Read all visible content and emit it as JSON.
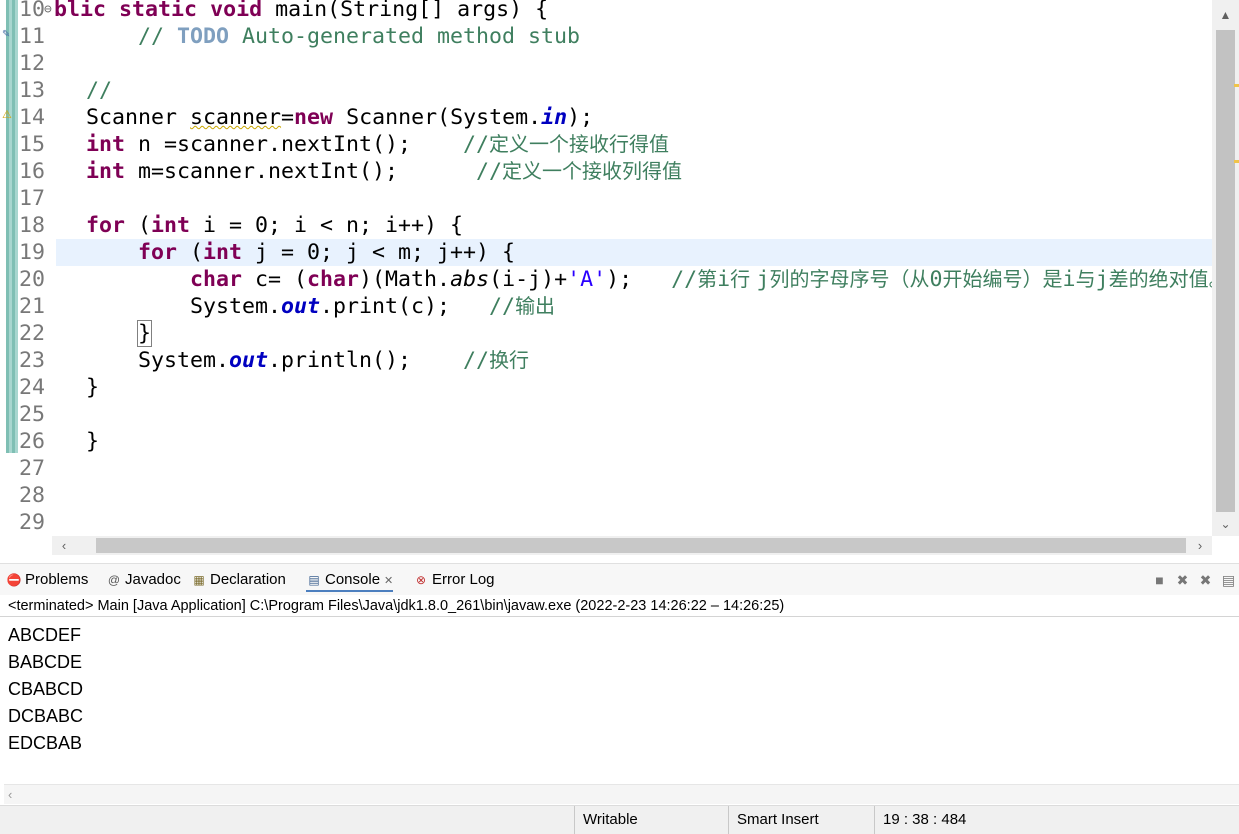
{
  "editor": {
    "lines": [
      {
        "num": "10",
        "fold": "⊖",
        "tokens": [
          {
            "t": "blic",
            "c": "kw"
          },
          {
            "t": " "
          },
          {
            "t": "static",
            "c": "kw"
          },
          {
            "t": " "
          },
          {
            "t": "void",
            "c": "kw"
          },
          {
            "t": " main(String[] args) {"
          }
        ],
        "indent": 0,
        "offset": -32
      },
      {
        "num": "11",
        "tokens": [
          {
            "t": "// ",
            "c": "cm"
          },
          {
            "t": "TODO",
            "c": "todo"
          },
          {
            "t": " Auto-generated method stub",
            "c": "cm"
          }
        ],
        "indent": 4
      },
      {
        "num": "12",
        "tokens": []
      },
      {
        "num": "13",
        "tokens": [
          {
            "t": "//",
            "c": "cm"
          }
        ],
        "indent": 0
      },
      {
        "num": "14",
        "tokens": [
          {
            "t": "Scanner "
          },
          {
            "t": "scanner",
            "c": "warn"
          },
          {
            "t": "="
          },
          {
            "t": "new",
            "c": "kw"
          },
          {
            "t": " Scanner(System."
          },
          {
            "t": "in",
            "c": "fld"
          },
          {
            "t": ");"
          }
        ],
        "indent": 0
      },
      {
        "num": "15",
        "tokens": [
          {
            "t": "int",
            "c": "kw"
          },
          {
            "t": " n =scanner.nextInt();    "
          },
          {
            "t": "//",
            "c": "cm"
          },
          {
            "t": "定义一个接收行得值",
            "c": "cmcjk"
          }
        ],
        "indent": 0
      },
      {
        "num": "16",
        "tokens": [
          {
            "t": "int",
            "c": "kw"
          },
          {
            "t": " m=scanner.nextInt();      "
          },
          {
            "t": "//",
            "c": "cm"
          },
          {
            "t": "定义一个接收列得值",
            "c": "cmcjk"
          }
        ],
        "indent": 0
      },
      {
        "num": "17",
        "tokens": []
      },
      {
        "num": "18",
        "tokens": [
          {
            "t": "for",
            "c": "kw"
          },
          {
            "t": " ("
          },
          {
            "t": "int",
            "c": "kw"
          },
          {
            "t": " i = 0; i < n; i++) {"
          }
        ],
        "indent": 0
      },
      {
        "num": "19",
        "current": true,
        "tokens": [
          {
            "t": "for",
            "c": "kw"
          },
          {
            "t": " ("
          },
          {
            "t": "int",
            "c": "kw"
          },
          {
            "t": " j = 0; j < m; j++) {"
          }
        ],
        "indent": 4
      },
      {
        "num": "20",
        "tokens": [
          {
            "t": "char",
            "c": "kw"
          },
          {
            "t": " c= ("
          },
          {
            "t": "char",
            "c": "kw"
          },
          {
            "t": ")(Math."
          },
          {
            "t": "abs",
            "c": "stat"
          },
          {
            "t": "(i-j)+"
          },
          {
            "t": "'A'",
            "c": "str"
          },
          {
            "t": ");   "
          },
          {
            "t": "//",
            "c": "cm"
          },
          {
            "t": "第",
            "c": "cmcjk"
          },
          {
            "t": "i",
            "c": "cm"
          },
          {
            "t": "行 ",
            "c": "cmcjk"
          },
          {
            "t": "j",
            "c": "cm"
          },
          {
            "t": "列的字母序号（从",
            "c": "cmcjk"
          },
          {
            "t": "0",
            "c": "cm"
          },
          {
            "t": "开始编号）是",
            "c": "cmcjk"
          },
          {
            "t": "i",
            "c": "cm"
          },
          {
            "t": "与",
            "c": "cmcjk"
          },
          {
            "t": "j",
            "c": "cm"
          },
          {
            "t": "差的绝对值。",
            "c": "cmcjk"
          }
        ],
        "indent": 8
      },
      {
        "num": "21",
        "tokens": [
          {
            "t": "System."
          },
          {
            "t": "out",
            "c": "fld"
          },
          {
            "t": ".print(c);   "
          },
          {
            "t": "//",
            "c": "cm"
          },
          {
            "t": "输出",
            "c": "cmcjk"
          }
        ],
        "indent": 8
      },
      {
        "num": "22",
        "tokens": [
          {
            "t": "}",
            "c": "box"
          }
        ],
        "indent": 4
      },
      {
        "num": "23",
        "tokens": [
          {
            "t": "System."
          },
          {
            "t": "out",
            "c": "fld"
          },
          {
            "t": ".println();    "
          },
          {
            "t": "//",
            "c": "cm"
          },
          {
            "t": "换行",
            "c": "cmcjk"
          }
        ],
        "indent": 4
      },
      {
        "num": "24",
        "tokens": [
          {
            "t": "}"
          }
        ],
        "indent": 0
      },
      {
        "num": "25",
        "tokens": []
      },
      {
        "num": "26",
        "tokens": [
          {
            "t": "}"
          }
        ],
        "indent": 0
      },
      {
        "num": "27",
        "tokens": []
      },
      {
        "num": "28",
        "tokens": []
      },
      {
        "num": "29",
        "tokens": []
      }
    ]
  },
  "panel": {
    "tabs": [
      {
        "label": "Problems",
        "icon": "problems-icon",
        "glyph": "⛔",
        "active": false
      },
      {
        "label": "Javadoc",
        "icon": "javadoc-icon",
        "glyph": "@",
        "active": false
      },
      {
        "label": "Declaration",
        "icon": "declaration-icon",
        "glyph": "🗎",
        "active": false
      },
      {
        "label": "Console",
        "icon": "console-icon",
        "glyph": "▤",
        "active": true,
        "close": "✕"
      },
      {
        "label": "Error Log",
        "icon": "error-log-icon",
        "glyph": "⊗",
        "active": false
      }
    ],
    "console_header": "<terminated> Main [Java Application] C:\\Program Files\\Java\\jdk1.8.0_261\\bin\\javaw.exe  (2022-2-23 14:26:22 – 14:26:25)",
    "output_lines": [
      "ABCDEF",
      "BABCDE",
      "CBABCD",
      "DCBABC",
      "EDCBAB"
    ]
  },
  "status": {
    "writable": "Writable",
    "insert_mode": "Smart Insert",
    "position": "19 : 38 : 484"
  },
  "colors": {
    "keyword": "#7f0055",
    "comment": "#3f7f5f",
    "string": "#2a00ff",
    "field": "#0000c0",
    "current_line": "#e8f2fe"
  }
}
